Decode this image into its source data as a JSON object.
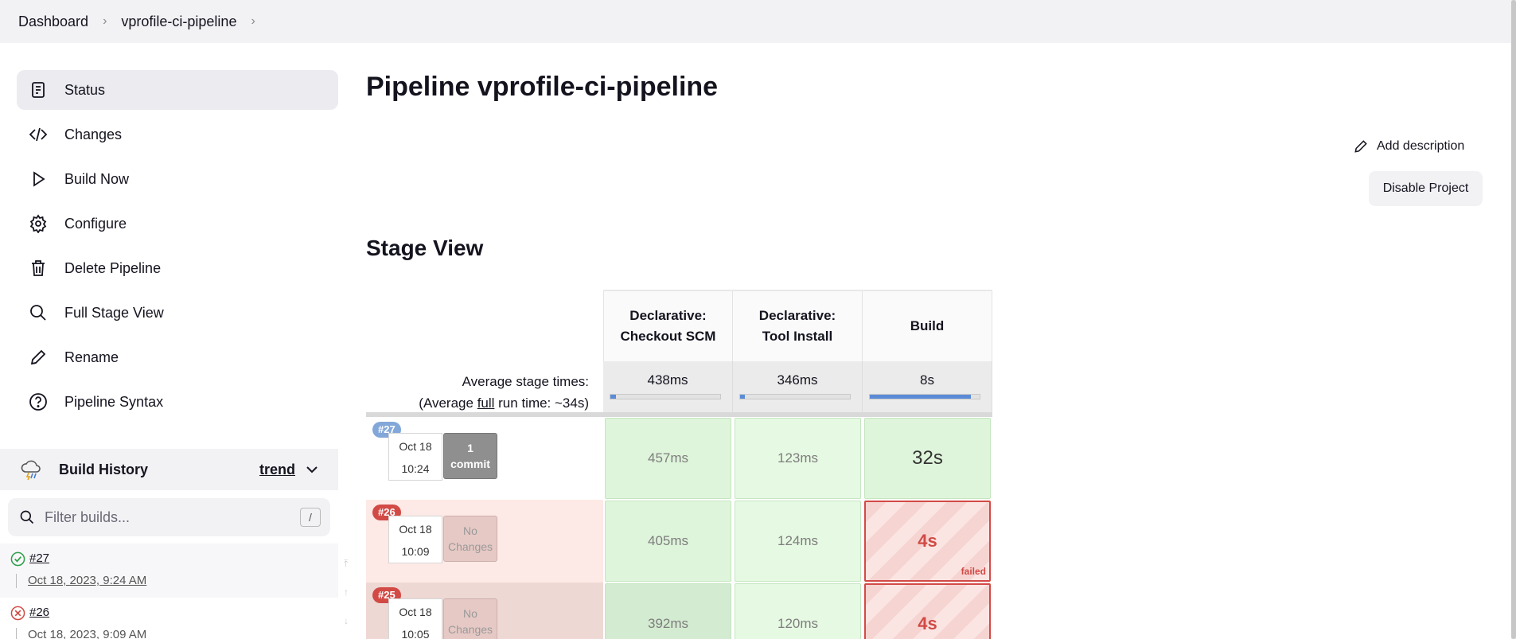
{
  "breadcrumb": {
    "items": [
      "Dashboard",
      "vprofile-ci-pipeline"
    ]
  },
  "sidebar": {
    "items": [
      {
        "label": "Status",
        "icon": "status-icon",
        "active": true
      },
      {
        "label": "Changes",
        "icon": "code-icon"
      },
      {
        "label": "Build Now",
        "icon": "play-icon"
      },
      {
        "label": "Configure",
        "icon": "gear-icon"
      },
      {
        "label": "Delete Pipeline",
        "icon": "trash-icon"
      },
      {
        "label": "Full Stage View",
        "icon": "search-icon"
      },
      {
        "label": "Rename",
        "icon": "pencil-icon"
      },
      {
        "label": "Pipeline Syntax",
        "icon": "help-icon"
      }
    ]
  },
  "build_history": {
    "title": "Build History",
    "trend": "trend",
    "filter_placeholder": "Filter builds...",
    "shortcut": "/",
    "builds": [
      {
        "number": "#27",
        "date": "Oct 18, 2023, 9:24 AM",
        "status": "success"
      },
      {
        "number": "#26",
        "date": "Oct 18, 2023, 9:09 AM",
        "status": "failed"
      }
    ]
  },
  "main": {
    "title": "Pipeline vprofile-ci-pipeline",
    "add_description": "Add description",
    "disable_project": "Disable Project",
    "stage_view_title": "Stage View"
  },
  "stage_view": {
    "stages": [
      {
        "line1": "Declarative:",
        "line2": "Checkout SCM",
        "avg": "438ms",
        "avg_fraction": 0.05
      },
      {
        "line1": "Declarative:",
        "line2": "Tool Install",
        "avg": "346ms",
        "avg_fraction": 0.04
      },
      {
        "line1": "Build",
        "line2": "",
        "avg": "8s",
        "avg_fraction": 0.92
      }
    ],
    "avg_label_1": "Average stage times:",
    "avg_label_2a": "(Average ",
    "avg_label_2b": "full",
    "avg_label_2c": " run time: ~34s)",
    "runs": [
      {
        "badge": "#27",
        "date": "Oct 18",
        "time": "10:24",
        "changes_1": "1",
        "changes_2": "commit",
        "times": [
          "457ms",
          "123ms",
          "32s"
        ],
        "failed_tag": ""
      },
      {
        "badge": "#26",
        "date": "Oct 18",
        "time": "10:09",
        "changes_1": "No",
        "changes_2": "Changes",
        "times": [
          "405ms",
          "124ms",
          "4s"
        ],
        "failed_tag": "failed"
      },
      {
        "badge": "#25",
        "date": "Oct 18",
        "time": "10:05",
        "changes_1": "No",
        "changes_2": "Changes",
        "times": [
          "392ms",
          "120ms",
          "4s"
        ],
        "failed_tag": ""
      }
    ]
  },
  "colors": {
    "success": "#2e9e4a",
    "failure": "#d24a45",
    "badge_blue": "#82a7d8"
  }
}
